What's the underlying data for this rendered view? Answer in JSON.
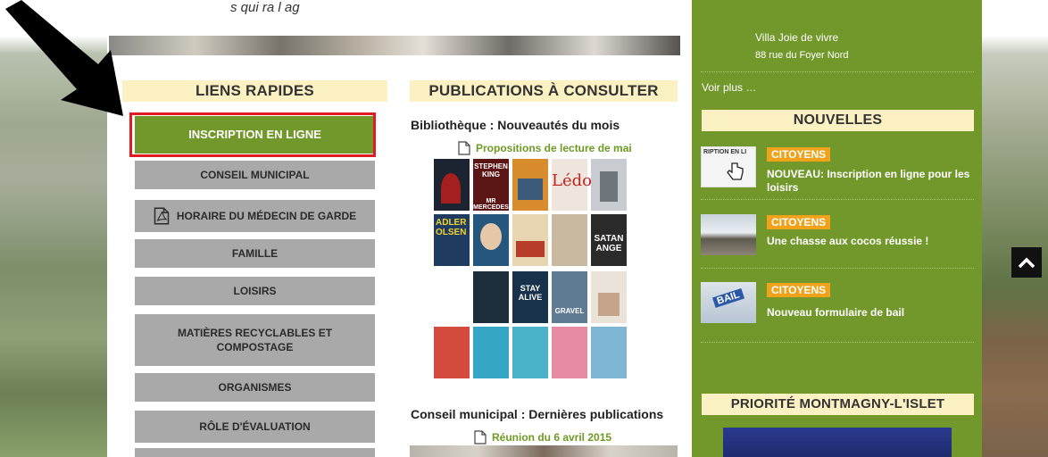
{
  "top_caption": "s qui     ra   l ag",
  "quick_links": {
    "heading": "LIENS RAPIDES",
    "items": [
      {
        "label": "Inscription en ligne",
        "primary": true
      },
      {
        "label": "Conseil municipal"
      },
      {
        "label": "Horaire du médecin de garde",
        "icon": "pdf-icon"
      },
      {
        "label": "Famille"
      },
      {
        "label": "Loisirs"
      },
      {
        "label": "Matières recyclables et compostage"
      },
      {
        "label": "Organismes"
      },
      {
        "label": "Rôle d'évaluation"
      }
    ]
  },
  "publications": {
    "heading": "PUBLICATIONS À CONSULTER",
    "library_title": "Bibliothèque : Nouveautés du mois",
    "library_link": "Propositions de lecture de mai",
    "book_titles": [
      "STEPHEN KING",
      "MR MERCEDES",
      "Lédo",
      "ADLER OLSEN",
      "SATAN ANGE",
      "STAY ALIVE",
      "GRAVEL"
    ],
    "council_title": "Conseil municipal : Dernières publications",
    "council_link": "Réunion du 6 avril 2015"
  },
  "sidebar": {
    "event_name": "Villa Joie de vivre",
    "event_address": "88 rue du Foyer Nord",
    "see_more": "Voir plus …",
    "news_heading": "NOUVELLES",
    "news": [
      {
        "category": "CITOYENS",
        "title": "NOUVEAU: Inscription en ligne pour les loisirs",
        "thumb_text": "RIPTION EN LI"
      },
      {
        "category": "CITOYENS",
        "title": "Une chasse aux cocos réussie !"
      },
      {
        "category": "CITOYENS",
        "title": "Nouveau formulaire de bail",
        "thumb_text": "BAIL"
      }
    ],
    "priority_heading": "PRIORITÉ MONTMAGNY-L'ISLET"
  },
  "colors": {
    "accent_green": "#72982b",
    "heading_bg": "#fbf1c2",
    "button_gray": "#a9a9a9",
    "category_orange": "#f0a31a",
    "highlight_red": "#e11b22"
  }
}
